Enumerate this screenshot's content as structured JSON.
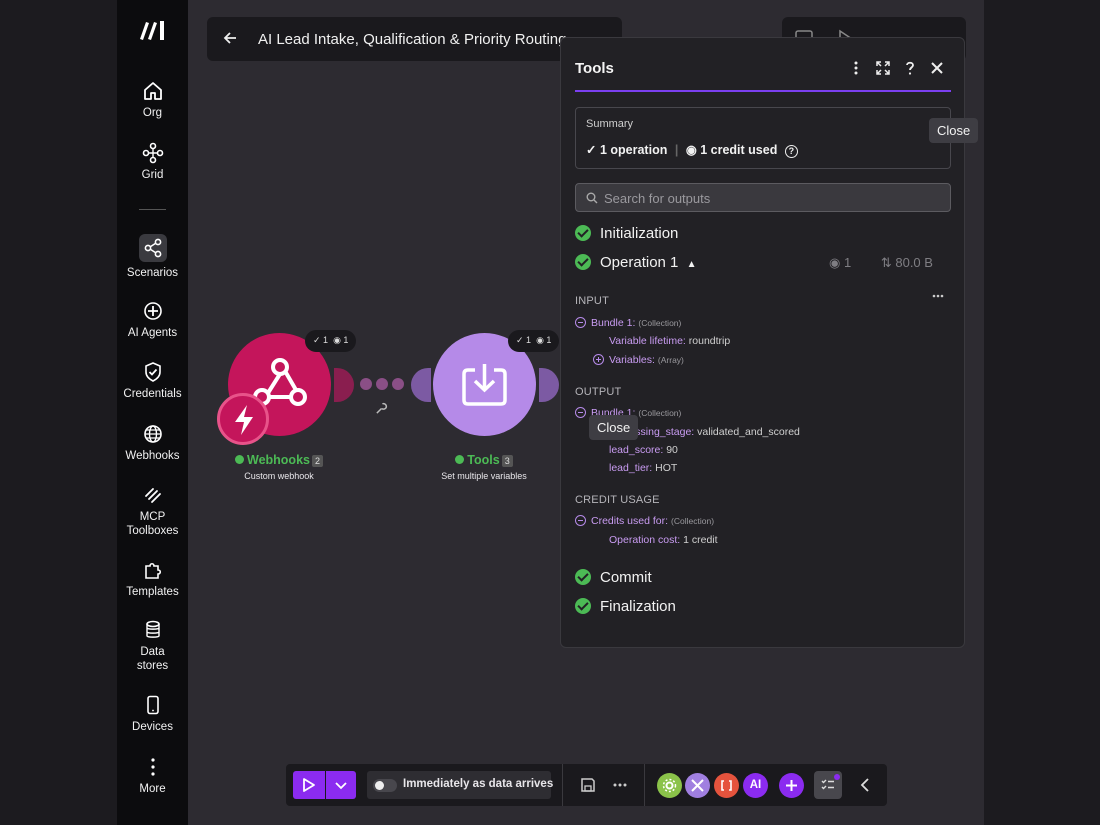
{
  "sidebar": {
    "items": [
      {
        "label": "Org",
        "icon": "home-icon"
      },
      {
        "label": "Grid",
        "icon": "grid-icon"
      },
      {
        "label": "Scenarios",
        "icon": "share-icon"
      },
      {
        "label": "AI Agents",
        "icon": "ai-agent-icon"
      },
      {
        "label": "Credentials",
        "icon": "shield-check-icon"
      },
      {
        "label": "Webhooks",
        "icon": "globe-icon"
      },
      {
        "label": "MCP",
        "label2": "Toolboxes",
        "icon": "mcp-icon"
      },
      {
        "label": "Templates",
        "icon": "puzzle-icon"
      },
      {
        "label": "Data",
        "label2": "stores",
        "icon": "database-icon"
      },
      {
        "label": "Devices",
        "icon": "phone-icon"
      },
      {
        "label": "More",
        "icon": "more-vertical-icon"
      }
    ]
  },
  "scenario": {
    "title": "AI Lead Intake, Qualification & Priority Routing"
  },
  "modules": {
    "webhook": {
      "name": "Webhooks",
      "num": "2",
      "sub": "Custom webhook",
      "ops": "1",
      "data": "1"
    },
    "tools": {
      "name": "Tools",
      "num": "3",
      "sub": "Set multiple variables",
      "ops": "1",
      "data": "1"
    }
  },
  "toolbar": {
    "schedule_label": "Immediately as data arrives",
    "ai_label": "AI"
  },
  "panel": {
    "title": "Tools",
    "summary_label": "Summary",
    "operations": "1 operation",
    "credits": "1 credit used",
    "search_placeholder": "Search for outputs",
    "stages": {
      "initialization": "Initialization",
      "operation": "Operation 1",
      "op_count": "1",
      "op_size": "80.0 B",
      "commit": "Commit",
      "finalization": "Finalization"
    },
    "input_label": "INPUT",
    "output_label": "OUTPUT",
    "credit_label": "CREDIT USAGE",
    "input": {
      "bundle": "Bundle 1:",
      "bundle_type": "(Collection)",
      "lifetime_key": "Variable lifetime:",
      "lifetime_val": "roundtrip",
      "vars_key": "Variables:",
      "vars_type": "(Array)"
    },
    "output": {
      "bundle": "Bundle 1:",
      "bundle_type": "(Collection)",
      "stage_key": "processing_stage:",
      "stage_val": "validated_and_scored",
      "score_key": "lead_score:",
      "score_val": "90",
      "tier_key": "lead_tier:",
      "tier_val": "HOT"
    },
    "credit": {
      "used_key": "Credits used for:",
      "used_type": "(Collection)",
      "cost_key": "Operation cost:",
      "cost_val": "1 credit"
    }
  },
  "tooltips": {
    "close_top": "Close",
    "close_mid": "Close"
  },
  "colors": {
    "accent": "#7b3ff0",
    "webhook": "#c4155b",
    "tools": "#b58ae8",
    "success": "#4cba55"
  }
}
